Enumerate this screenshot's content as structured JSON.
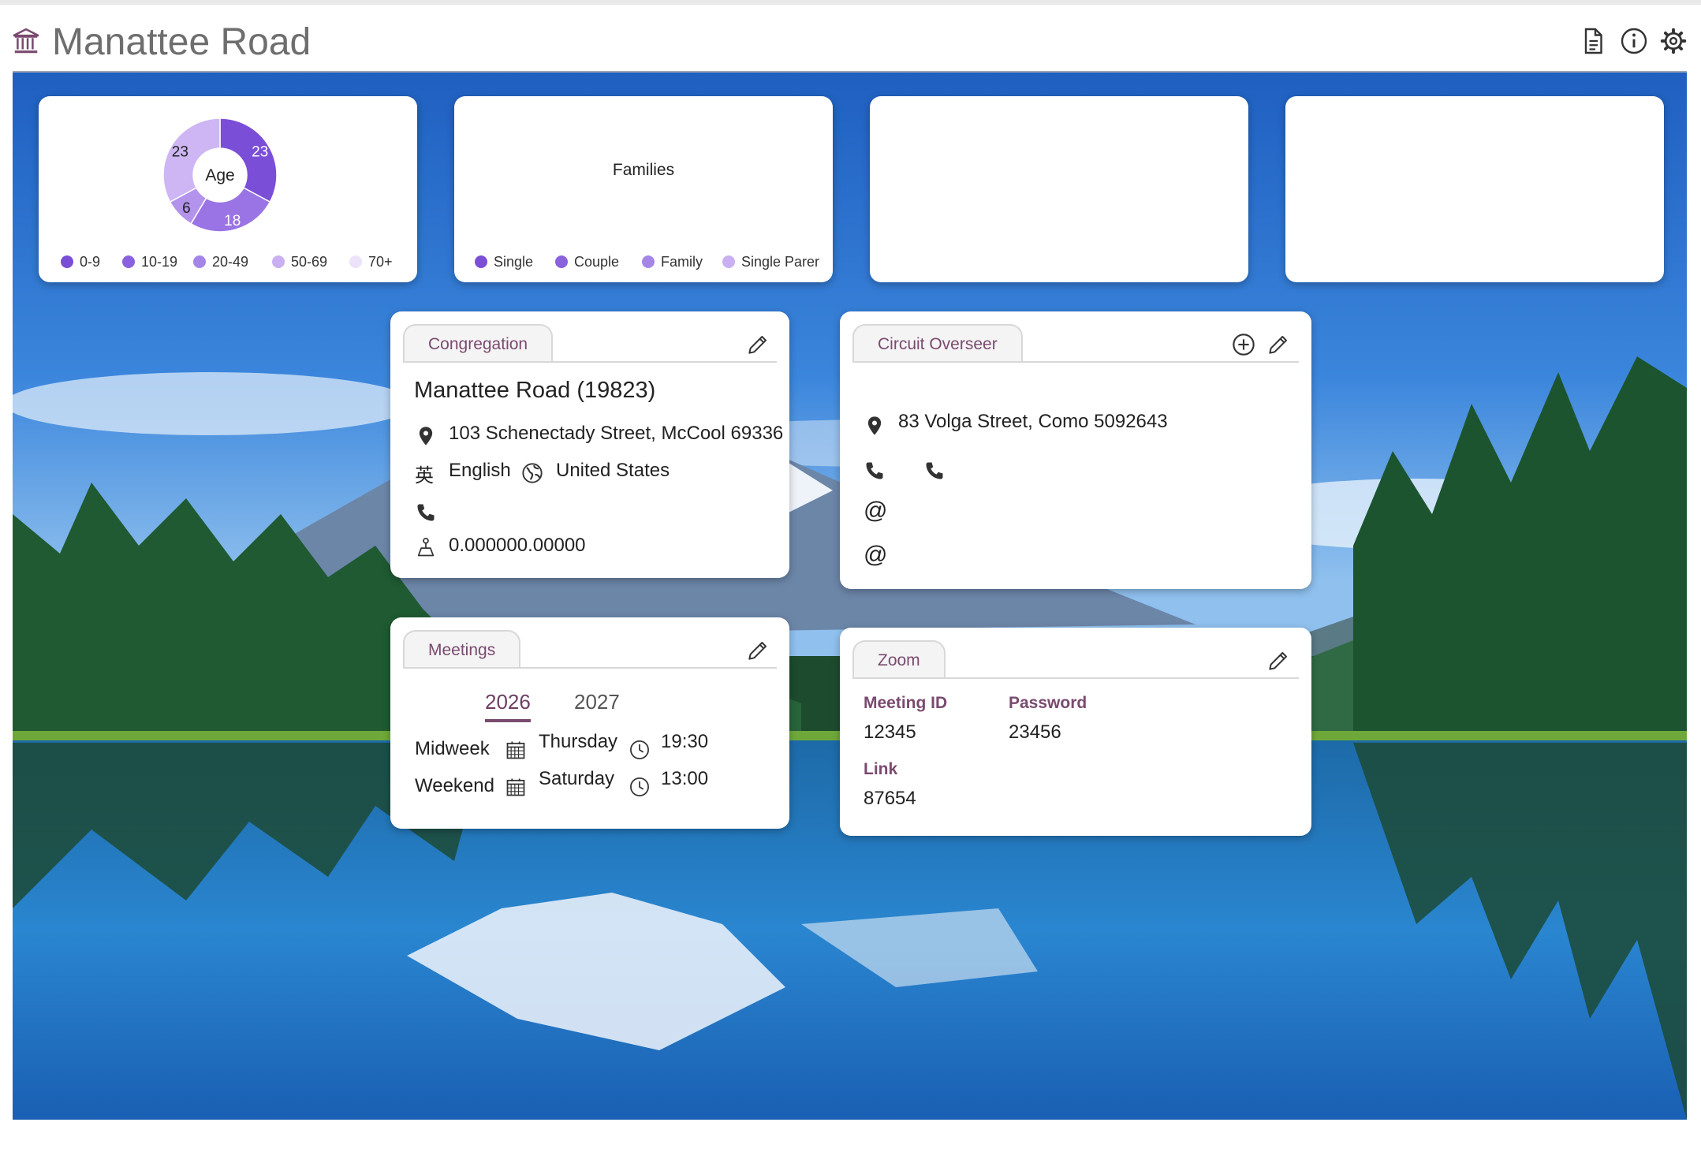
{
  "header": {
    "title": "Manattee Road"
  },
  "stats": {
    "age": {
      "center_label": "Age",
      "legend": [
        "0-9",
        "10-19",
        "20-49",
        "50-69",
        "70+"
      ]
    },
    "families": {
      "center_label": "Families",
      "legend": [
        "Single",
        "Couple",
        "Family",
        "Single Parer"
      ]
    }
  },
  "chart_data": {
    "type": "pie",
    "title": "Age",
    "categories": [
      "0-9",
      "10-19",
      "20-49",
      "50-69",
      "70+"
    ],
    "values": [
      23,
      18,
      6,
      23,
      0
    ],
    "legend_position": "bottom"
  },
  "congregation": {
    "tab": "Congregation",
    "name": "Manattee Road (19823)",
    "address": "103 Schenectady Street, McCool 69336",
    "language": "English",
    "country": "United States",
    "coordinates": "0.000000.00000"
  },
  "circuit_overseer": {
    "tab": "Circuit Overseer",
    "address": "83 Volga Street, Como 5092643"
  },
  "meetings": {
    "tab": "Meetings",
    "years": [
      "2026",
      "2027"
    ],
    "midweek": {
      "label": "Midweek",
      "day": "Thursday",
      "time": "19:30"
    },
    "weekend": {
      "label": "Weekend",
      "day": "Saturday",
      "time": "13:00"
    }
  },
  "zoom": {
    "tab": "Zoom",
    "meeting_id_label": "Meeting ID",
    "meeting_id": "12345",
    "password_label": "Password",
    "password": "23456",
    "link_label": "Link",
    "link": "87654"
  },
  "colors": {
    "accent": "#7a4a6f",
    "purple_dark": "#7b4ed8",
    "purple_mid": "#9a74e4",
    "purple_light": "#c3a9f0",
    "purple_pale": "#d8c6f6"
  }
}
